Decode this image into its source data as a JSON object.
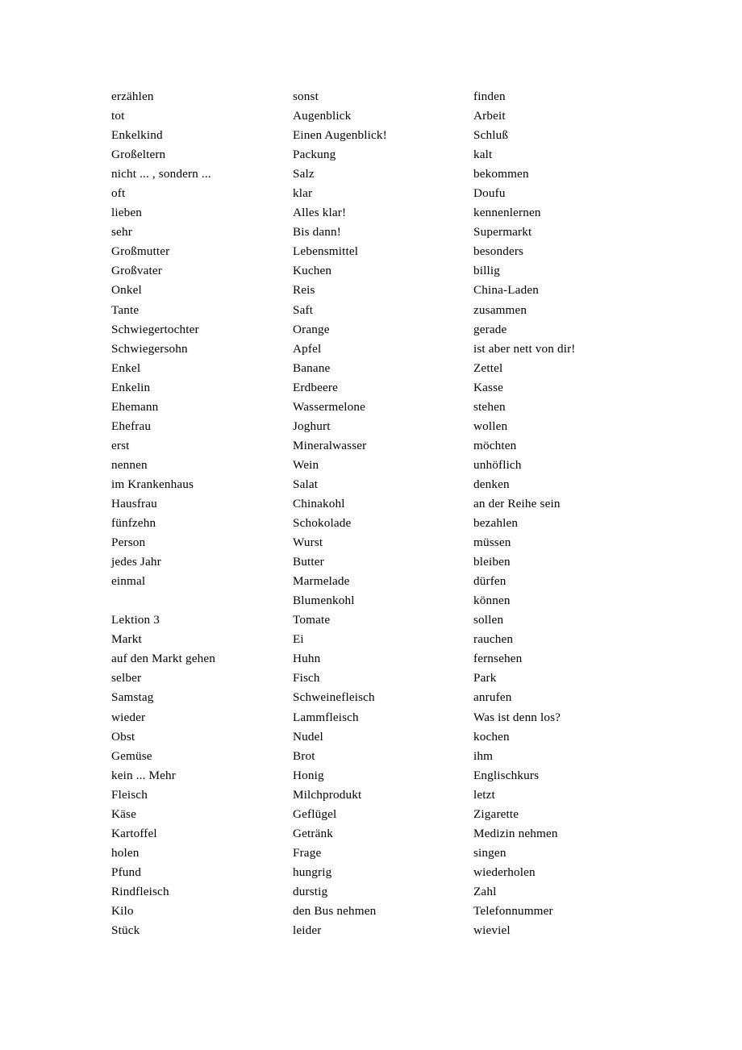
{
  "document": {
    "type": "vocabulary-word-list",
    "language": "German",
    "page_background": "#ffffff",
    "text_color": "#000000",
    "column_count": 3
  },
  "columns": [
    {
      "id": "column-1",
      "entries": [
        "erzählen",
        "tot",
        "Enkelkind",
        "Großeltern",
        "nicht ... , sondern ...",
        "oft",
        "lieben",
        "sehr",
        "Großmutter",
        "Großvater",
        "Onkel",
        "Tante",
        "Schwiegertochter",
        "Schwiegersohn",
        "Enkel",
        "Enkelin",
        "Ehemann",
        "Ehefrau",
        "erst",
        "nennen",
        "im Krankenhaus",
        "Hausfrau",
        "fünfzehn",
        "Person",
        "jedes Jahr",
        "einmal",
        "",
        "Lektion 3",
        "Markt",
        "auf den Markt gehen",
        "selber",
        "Samstag",
        "wieder",
        "Obst",
        "Gemüse",
        "kein ... Mehr",
        "Fleisch",
        "Käse",
        "Kartoffel",
        "holen",
        "Pfund",
        "Rindfleisch",
        "Kilo",
        "Stück"
      ]
    },
    {
      "id": "column-2",
      "entries": [
        "sonst",
        "Augenblick",
        "Einen Augenblick!",
        "Packung",
        "Salz",
        "klar",
        "Alles klar!",
        "Bis dann!",
        "Lebensmittel",
        "Kuchen",
        "Reis",
        "Saft",
        "Orange",
        "Apfel",
        "Banane",
        "Erdbeere",
        "Wassermelone",
        "Joghurt",
        "Mineralwasser",
        "Wein",
        "Salat",
        "Chinakohl",
        "Schokolade",
        "Wurst",
        "Butter",
        "Marmelade",
        "Blumenkohl",
        "Tomate",
        "Ei",
        "Huhn",
        "Fisch",
        "Schweinefleisch",
        "Lammfleisch",
        "Nudel",
        "Brot",
        "Honig",
        "Milchprodukt",
        "Geflügel",
        "Getränk",
        "Frage",
        "hungrig",
        "durstig",
        "den Bus nehmen",
        "leider"
      ]
    },
    {
      "id": "column-3",
      "entries": [
        "finden",
        "Arbeit",
        "Schluß",
        "kalt",
        "bekommen",
        "Doufu",
        "kennenlernen",
        "Supermarkt",
        "besonders",
        "billig",
        "China-Laden",
        "zusammen",
        "gerade",
        "ist aber nett von dir!",
        "Zettel",
        "Kasse",
        "stehen",
        "wollen",
        "möchten",
        "unhöflich",
        "denken",
        "an der Reihe sein",
        "bezahlen",
        "müssen",
        "bleiben",
        "dürfen",
        "können",
        "sollen",
        "rauchen",
        "fernsehen",
        "Park",
        "anrufen",
        "Was ist denn los?",
        "kochen",
        "ihm",
        "Englischkurs",
        "letzt",
        "Zigarette",
        "Medizin nehmen",
        "singen",
        "wiederholen",
        "Zahl",
        "Telefonnummer",
        "wieviel"
      ]
    }
  ]
}
